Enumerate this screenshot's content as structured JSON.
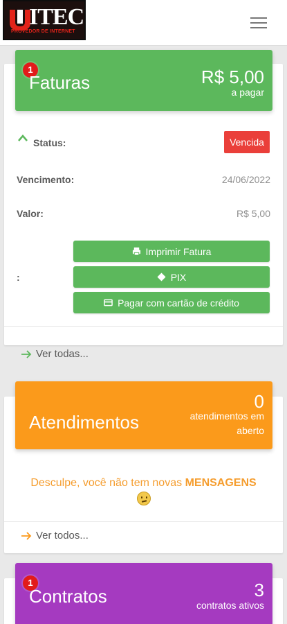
{
  "brand": {
    "name": "ITEC",
    "tagline": "PROVEDOR DE INTERNET"
  },
  "faturas": {
    "badge": "1",
    "title": "Faturas",
    "amount": "R$ 5,00",
    "amount_sub": "a pagar",
    "status_label": "Status:",
    "status_value": "Vencida",
    "vencimento_label": "Vencimento:",
    "vencimento_value": "24/06/2022",
    "valor_label": "Valor:",
    "valor_value": "R$ 5,00",
    "actions_label": ":",
    "buttons": [
      "Imprimir Fatura",
      "PIX",
      "Pagar com cartão de crédito"
    ],
    "see_all": "Ver todas..."
  },
  "atendimentos": {
    "title": "Atendimentos",
    "count": "0",
    "count_sub_1": "atendimentos em",
    "count_sub_2": "aberto",
    "message_prefix": "Desculpe, você não tem novas",
    "message_bold": "MENSAGENS",
    "see_all": "Ver todos..."
  },
  "contratos": {
    "badge": "1",
    "title": "Contratos",
    "count": "3",
    "count_sub": "contratos ativos"
  },
  "colors": {
    "green": "#5cb85c",
    "orange": "#fb9a1b",
    "purple": "#a53ac0",
    "red": "#ea3f3a"
  }
}
